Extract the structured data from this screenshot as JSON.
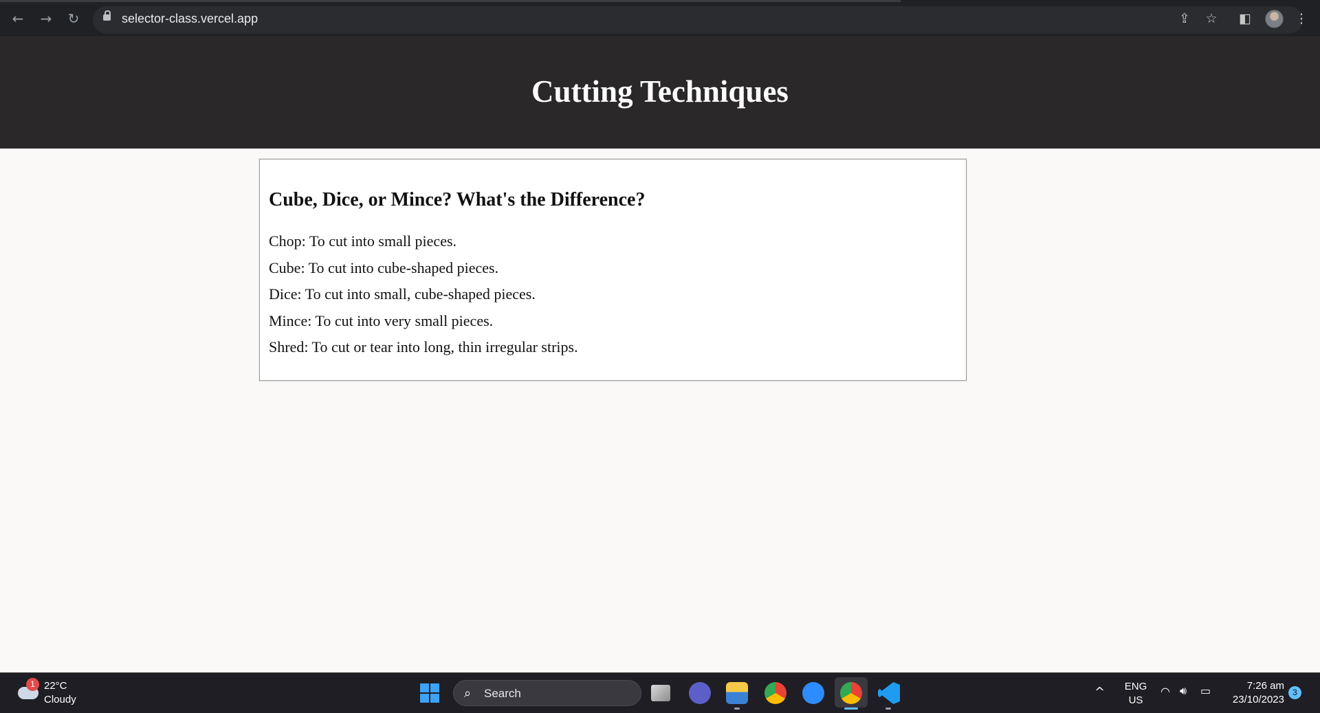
{
  "browser": {
    "url": "selector-class.vercel.app",
    "icons": [
      "back-arrow-icon",
      "forward-arrow-icon",
      "reload-icon",
      "lock-icon",
      "share-icon",
      "star-icon",
      "side-panel-icon",
      "profile-avatar",
      "more-menu-icon"
    ]
  },
  "page": {
    "title": "Cutting Techniques",
    "card": {
      "heading": "Cube, Dice, or Mince? What's the Difference?",
      "items": [
        "Chop: To cut into small pieces.",
        "Cube: To cut into cube-shaped pieces.",
        "Dice: To cut into small, cube-shaped pieces.",
        "Mince: To cut into very small pieces.",
        "Shred: To cut or tear into long, thin irregular strips."
      ]
    }
  },
  "taskbar": {
    "weather": {
      "temp": "22°C",
      "condition": "Cloudy",
      "badge": "1"
    },
    "search_label": "Search",
    "apps": [
      "windows-start-icon",
      "task-view-icon",
      "teams-chat-icon",
      "file-explorer-icon",
      "chrome-icon",
      "zoom-icon",
      "chrome-active-icon",
      "vscode-icon"
    ],
    "lang_top": "ENG",
    "lang_bottom": "US",
    "time": "7:26 am",
    "date": "23/10/2023",
    "notifications": "3"
  },
  "colors": {
    "header_bg": "#2a2828",
    "page_bg": "#faf9f8",
    "chrome_bg": "#202124",
    "taskbar_bg": "#1f1e24"
  }
}
